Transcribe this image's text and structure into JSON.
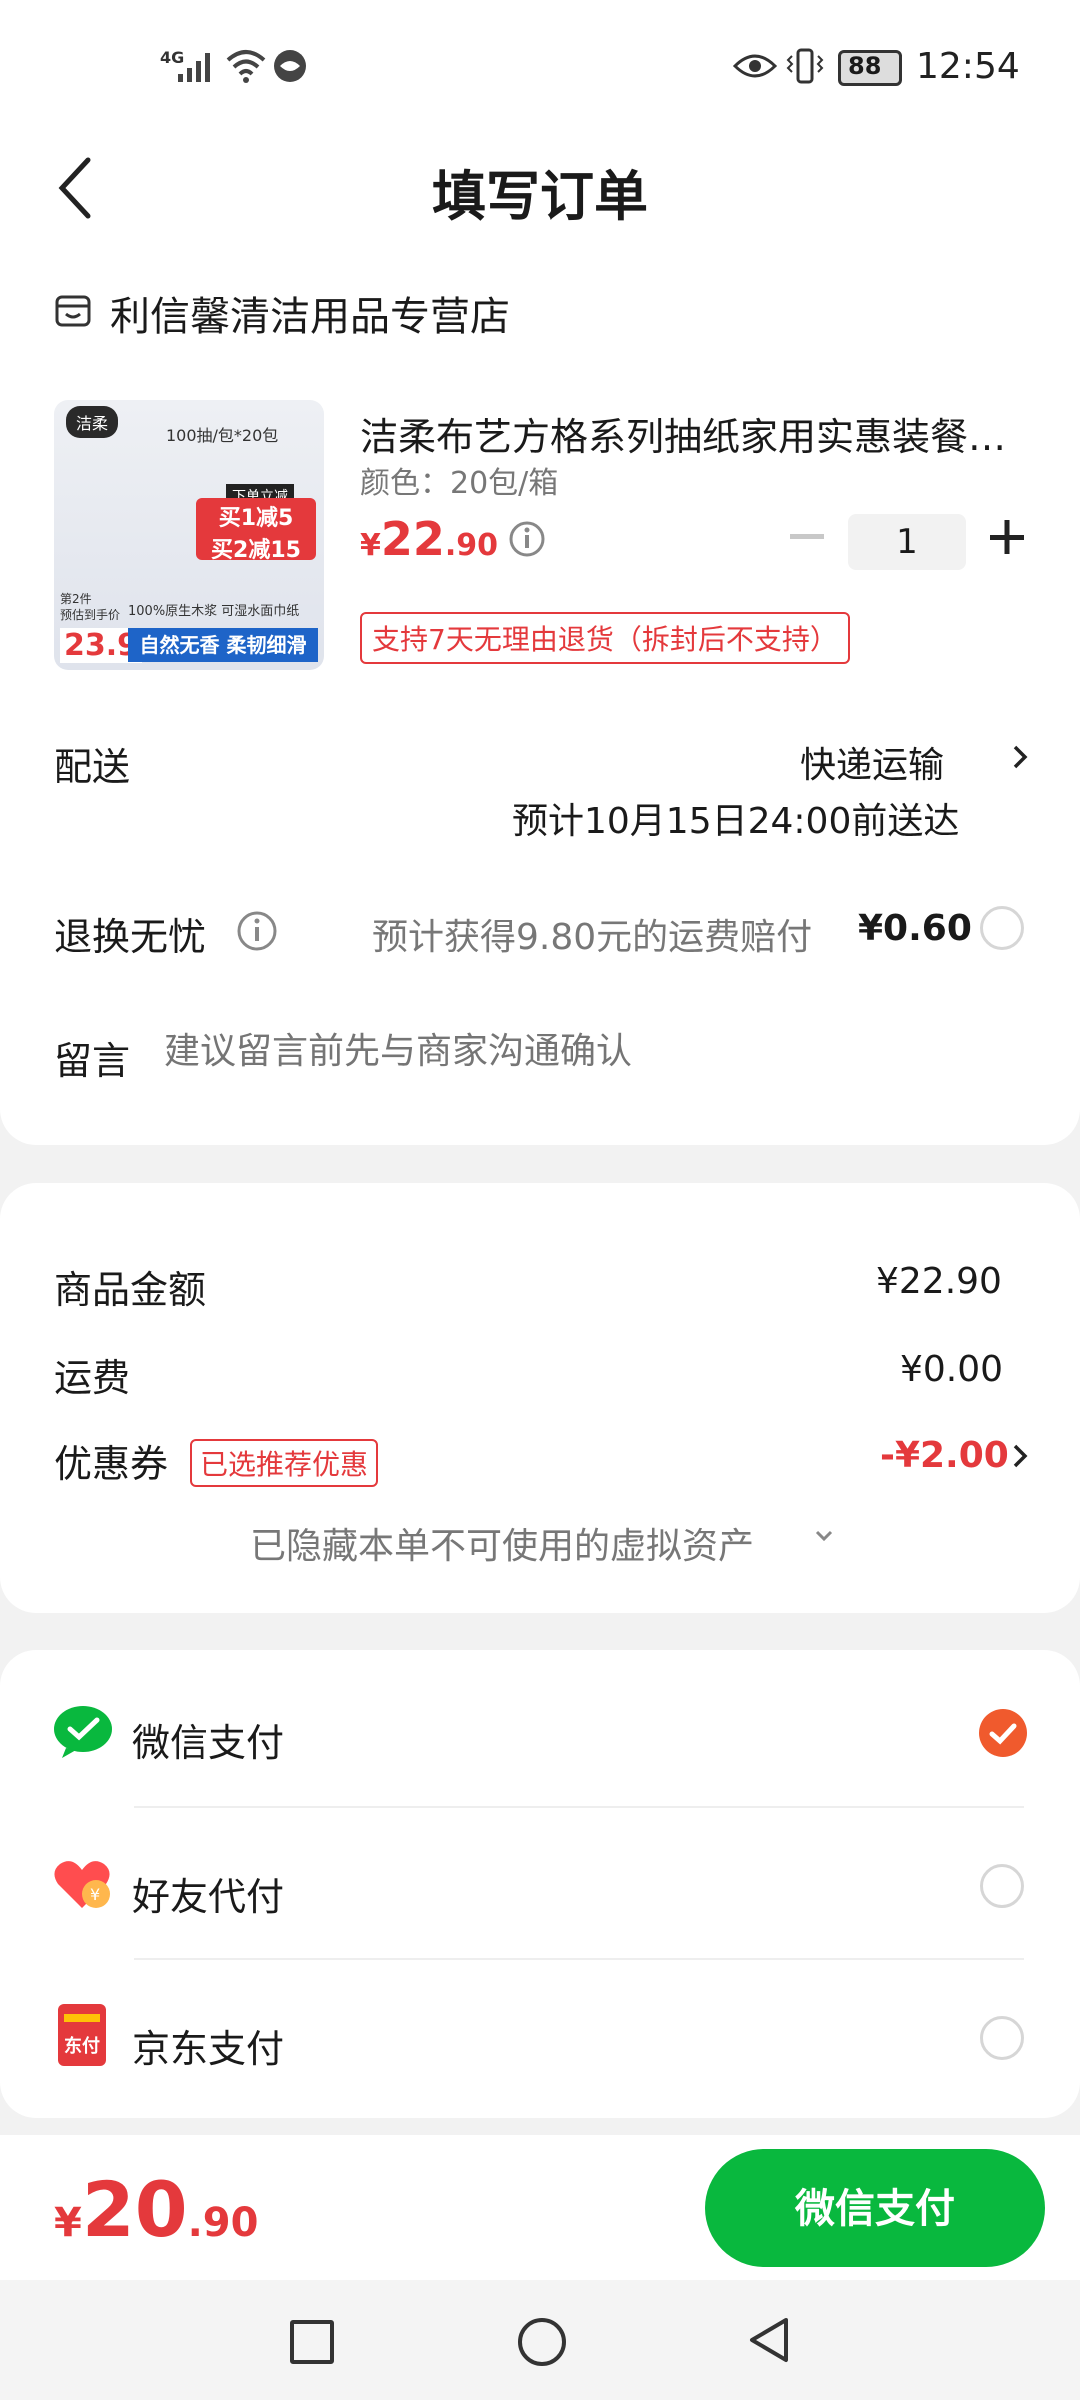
{
  "status_bar": {
    "network": "4G",
    "battery": "88",
    "time": "12:54"
  },
  "header": {
    "title": "填写订单"
  },
  "store": {
    "name": "利信馨清洁用品专营店"
  },
  "product": {
    "title": "洁柔布艺方格系列抽纸家用实惠装餐巾纸...",
    "spec": "颜色：20包/箱",
    "price_symbol": "¥",
    "price_int": "22",
    "price_dec": ".90",
    "quantity": "1",
    "return_tag": "支持7天无理由退货（拆封后不支持）",
    "image_texts": {
      "brand": "洁柔",
      "pack": "100抽/包*20包",
      "promo_top": "下单立减",
      "promo_1": "买1减5",
      "promo_2": "买2减15",
      "quality": "100%原生木浆 可湿水面巾纸",
      "price_label": "第2件",
      "price_note": "预估到手价",
      "price": "23.9",
      "slogan": "自然无香 柔韧细滑"
    }
  },
  "delivery": {
    "label": "配送",
    "method": "快递运输",
    "eta": "预计10月15日24:00前送达"
  },
  "return_worry": {
    "label": "退换无忧",
    "desc": "预计获得9.80元的运费赔付",
    "price": "¥0.60"
  },
  "message": {
    "label": "留言",
    "placeholder": "建议留言前先与商家沟通确认"
  },
  "summary": {
    "goods_label": "商品金额",
    "goods_value": "¥22.90",
    "shipping_label": "运费",
    "shipping_value": "¥0.00",
    "coupon_label": "优惠券",
    "coupon_tag": "已选推荐优惠",
    "coupon_value": "-¥2.00",
    "hidden_note": "已隐藏本单不可使用的虚拟资产"
  },
  "payment": {
    "methods": [
      {
        "label": "微信支付",
        "selected": true
      },
      {
        "label": "好友代付",
        "selected": false
      },
      {
        "label": "京东支付",
        "selected": false
      }
    ],
    "jd_icon_text": "东付"
  },
  "footer": {
    "total_symbol": "¥",
    "total_int": "20",
    "total_dec": ".90",
    "pay_button": "微信支付"
  },
  "colors": {
    "accent_red": "#e4393c",
    "wechat_green": "#09b83e",
    "selected_orange": "#f05a2d"
  }
}
